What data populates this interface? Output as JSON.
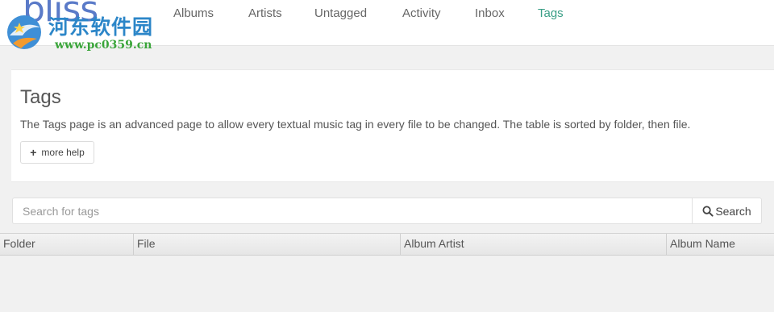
{
  "brand": {
    "logo_text": "bliss",
    "watermark_title": "河东软件园",
    "watermark_url": "www.pc0359.cn"
  },
  "nav": {
    "items": [
      {
        "label": "Albums",
        "active": false
      },
      {
        "label": "Artists",
        "active": false
      },
      {
        "label": "Untagged",
        "active": false
      },
      {
        "label": "Activity",
        "active": false
      },
      {
        "label": "Inbox",
        "active": false
      },
      {
        "label": "Tags",
        "active": true
      }
    ],
    "active_color": "#3a9e86"
  },
  "header": {
    "title": "Tags",
    "description": "The Tags page is an advanced page to allow every textual music tag in every file to be changed. The table is sorted by folder, then file.",
    "help_button_label": "more help",
    "help_button_icon": "plus-icon"
  },
  "search": {
    "placeholder": "Search for tags",
    "value": "",
    "button_label": "Search",
    "button_icon": "search-icon"
  },
  "table": {
    "columns": [
      "Folder",
      "File",
      "Album Artist",
      "Album Name"
    ],
    "rows": []
  }
}
